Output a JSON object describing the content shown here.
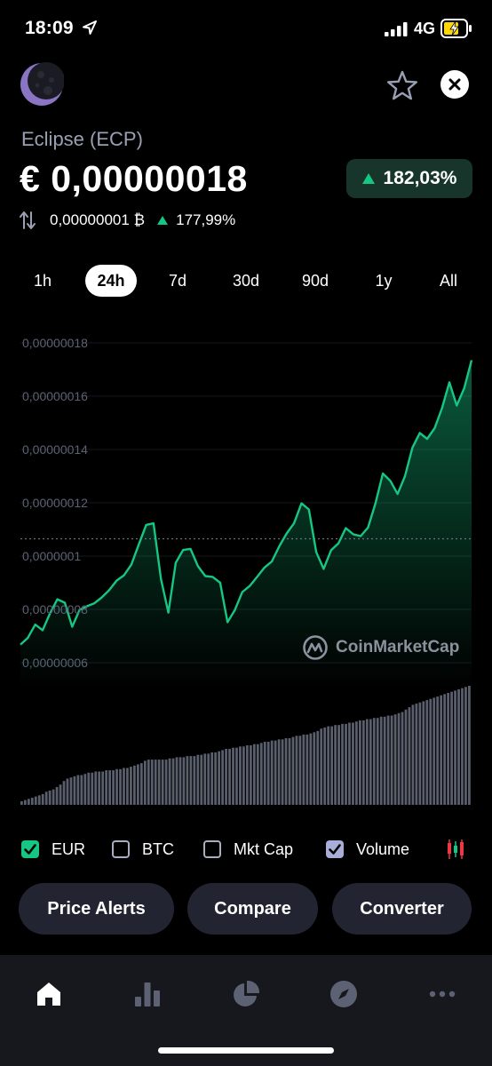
{
  "status_bar": {
    "time": "18:09",
    "network": "4G"
  },
  "coin": {
    "name": "Eclipse (ECP)",
    "price": "€ 0,00000018",
    "change_pct": "182,03%",
    "btc_price": "0,00000001 ₿",
    "btc_change_pct": "177,99%"
  },
  "range_tabs": [
    {
      "label": "1h"
    },
    {
      "label": "24h",
      "active": true
    },
    {
      "label": "7d"
    },
    {
      "label": "30d"
    },
    {
      "label": "90d"
    },
    {
      "label": "1y"
    },
    {
      "label": "All"
    }
  ],
  "watermark": "CoinMarketCap",
  "chart_data": {
    "type": "area",
    "ytick_labels": [
      "0,00000018",
      "0,00000016",
      "0,00000014",
      "0,00000012",
      "0,0000001",
      "0,00000008",
      "0,00000006"
    ],
    "ylim": [
      5.8e-08,
      1.84e-07
    ],
    "reference_line": 1.065e-07,
    "series": [
      {
        "values": [
          6.68e-08,
          6.93e-08,
          7.43e-08,
          7.22e-08,
          7.85e-08,
          8.38e-08,
          8.25e-08,
          7.35e-08,
          7.98e-08,
          8.12e-08,
          8.23e-08,
          8.45e-08,
          8.72e-08,
          9.08e-08,
          9.28e-08,
          9.68e-08,
          1.043e-07,
          1.117e-07,
          1.123e-07,
          9.15e-08,
          7.88e-08,
          9.75e-08,
          1.023e-07,
          1.027e-07,
          9.62e-08,
          9.25e-08,
          9.22e-08,
          9e-08,
          7.52e-08,
          7.98e-08,
          8.65e-08,
          8.88e-08,
          9.22e-08,
          9.57e-08,
          9.8e-08,
          1.037e-07,
          1.085e-07,
          1.123e-07,
          1.198e-07,
          1.175e-07,
          1.015e-07,
          9.52e-08,
          1.022e-07,
          1.048e-07,
          1.105e-07,
          1.082e-07,
          1.075e-07,
          1.107e-07,
          1.197e-07,
          1.31e-07,
          1.283e-07,
          1.233e-07,
          1.3e-07,
          1.407e-07,
          1.462e-07,
          1.44e-07,
          1.48e-07,
          1.555e-07,
          1.652e-07,
          1.565e-07,
          1.63e-07,
          1.735e-07
        ],
        "color": "#16c784"
      }
    ],
    "volume_series": {
      "values": [
        3,
        4,
        5,
        6,
        7,
        8,
        9,
        11,
        12,
        13,
        15,
        17,
        20,
        22,
        23,
        24,
        25,
        25,
        26,
        27,
        27,
        28,
        28,
        28,
        29,
        29,
        29,
        30,
        30,
        31,
        31,
        32,
        33,
        34,
        35,
        37,
        38,
        38,
        38,
        38,
        38,
        38,
        39,
        39,
        40,
        40,
        40,
        41,
        41,
        41,
        42,
        42,
        43,
        43,
        44,
        44,
        45,
        46,
        47,
        47,
        48,
        48,
        49,
        49,
        50,
        50,
        51,
        51,
        52,
        53,
        53,
        54,
        54,
        55,
        55,
        56,
        56,
        57,
        58,
        58,
        59,
        59,
        60,
        61,
        62,
        64,
        65,
        66,
        66,
        67,
        67,
        68,
        68,
        69,
        69,
        70,
        71,
        71,
        72,
        72,
        73,
        73,
        74,
        74,
        75,
        75,
        76,
        77,
        78,
        80,
        82,
        84,
        85,
        86,
        87,
        88,
        89,
        90,
        91,
        92,
        93,
        94,
        95,
        96,
        97,
        98,
        99,
        100
      ],
      "color": "#5a5f6e"
    }
  },
  "toggles": [
    {
      "label": "EUR",
      "checked": true,
      "color": "#16c784"
    },
    {
      "label": "BTC",
      "checked": false
    },
    {
      "label": "Mkt Cap",
      "checked": false
    },
    {
      "label": "Volume",
      "checked": true,
      "color": "#a9aed8"
    }
  ],
  "actions": {
    "price_alerts": "Price Alerts",
    "compare": "Compare",
    "converter": "Converter"
  },
  "nav_icons": [
    "home-icon",
    "bar-chart-icon",
    "pie-chart-icon",
    "compass-icon",
    "more-icon"
  ],
  "colors": {
    "accent_green": "#16c784",
    "background": "#000000",
    "button_bg": "#222531",
    "tabbar_bg": "#17181d"
  }
}
